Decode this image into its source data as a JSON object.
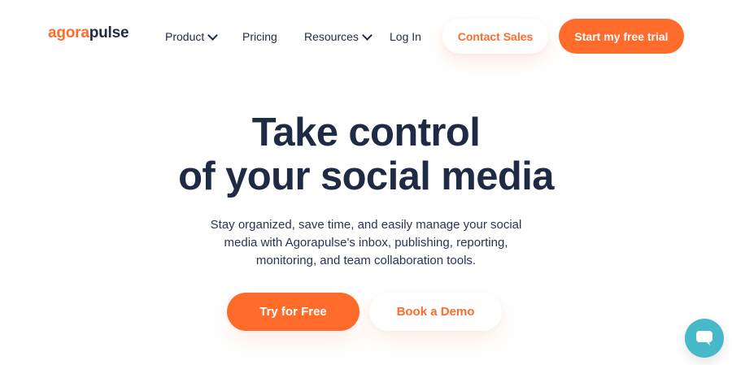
{
  "brand": {
    "name_part1": "agora",
    "name_part2": "pulse",
    "colors": {
      "accent": "#ff6b2b",
      "text": "#1f2a44",
      "chat": "#48b9c8"
    }
  },
  "nav": {
    "items": [
      {
        "label": "Product",
        "has_dropdown": true
      },
      {
        "label": "Pricing",
        "has_dropdown": false
      },
      {
        "label": "Resources",
        "has_dropdown": true
      },
      {
        "label": "Log In",
        "has_dropdown": false
      }
    ],
    "contact_label": "Contact Sales",
    "trial_label": "Start my free trial"
  },
  "hero": {
    "title_lines": [
      "Take control",
      "of your social media"
    ],
    "subtitle_lines": [
      "Stay organized, save time, and easily manage your social",
      "media with Agorapulse's inbox, publishing, reporting,",
      "monitoring, and team collaboration tools."
    ],
    "primary_cta": "Try for Free",
    "secondary_cta": "Book a Demo"
  },
  "chat": {
    "icon": "chat-bubble-icon"
  }
}
